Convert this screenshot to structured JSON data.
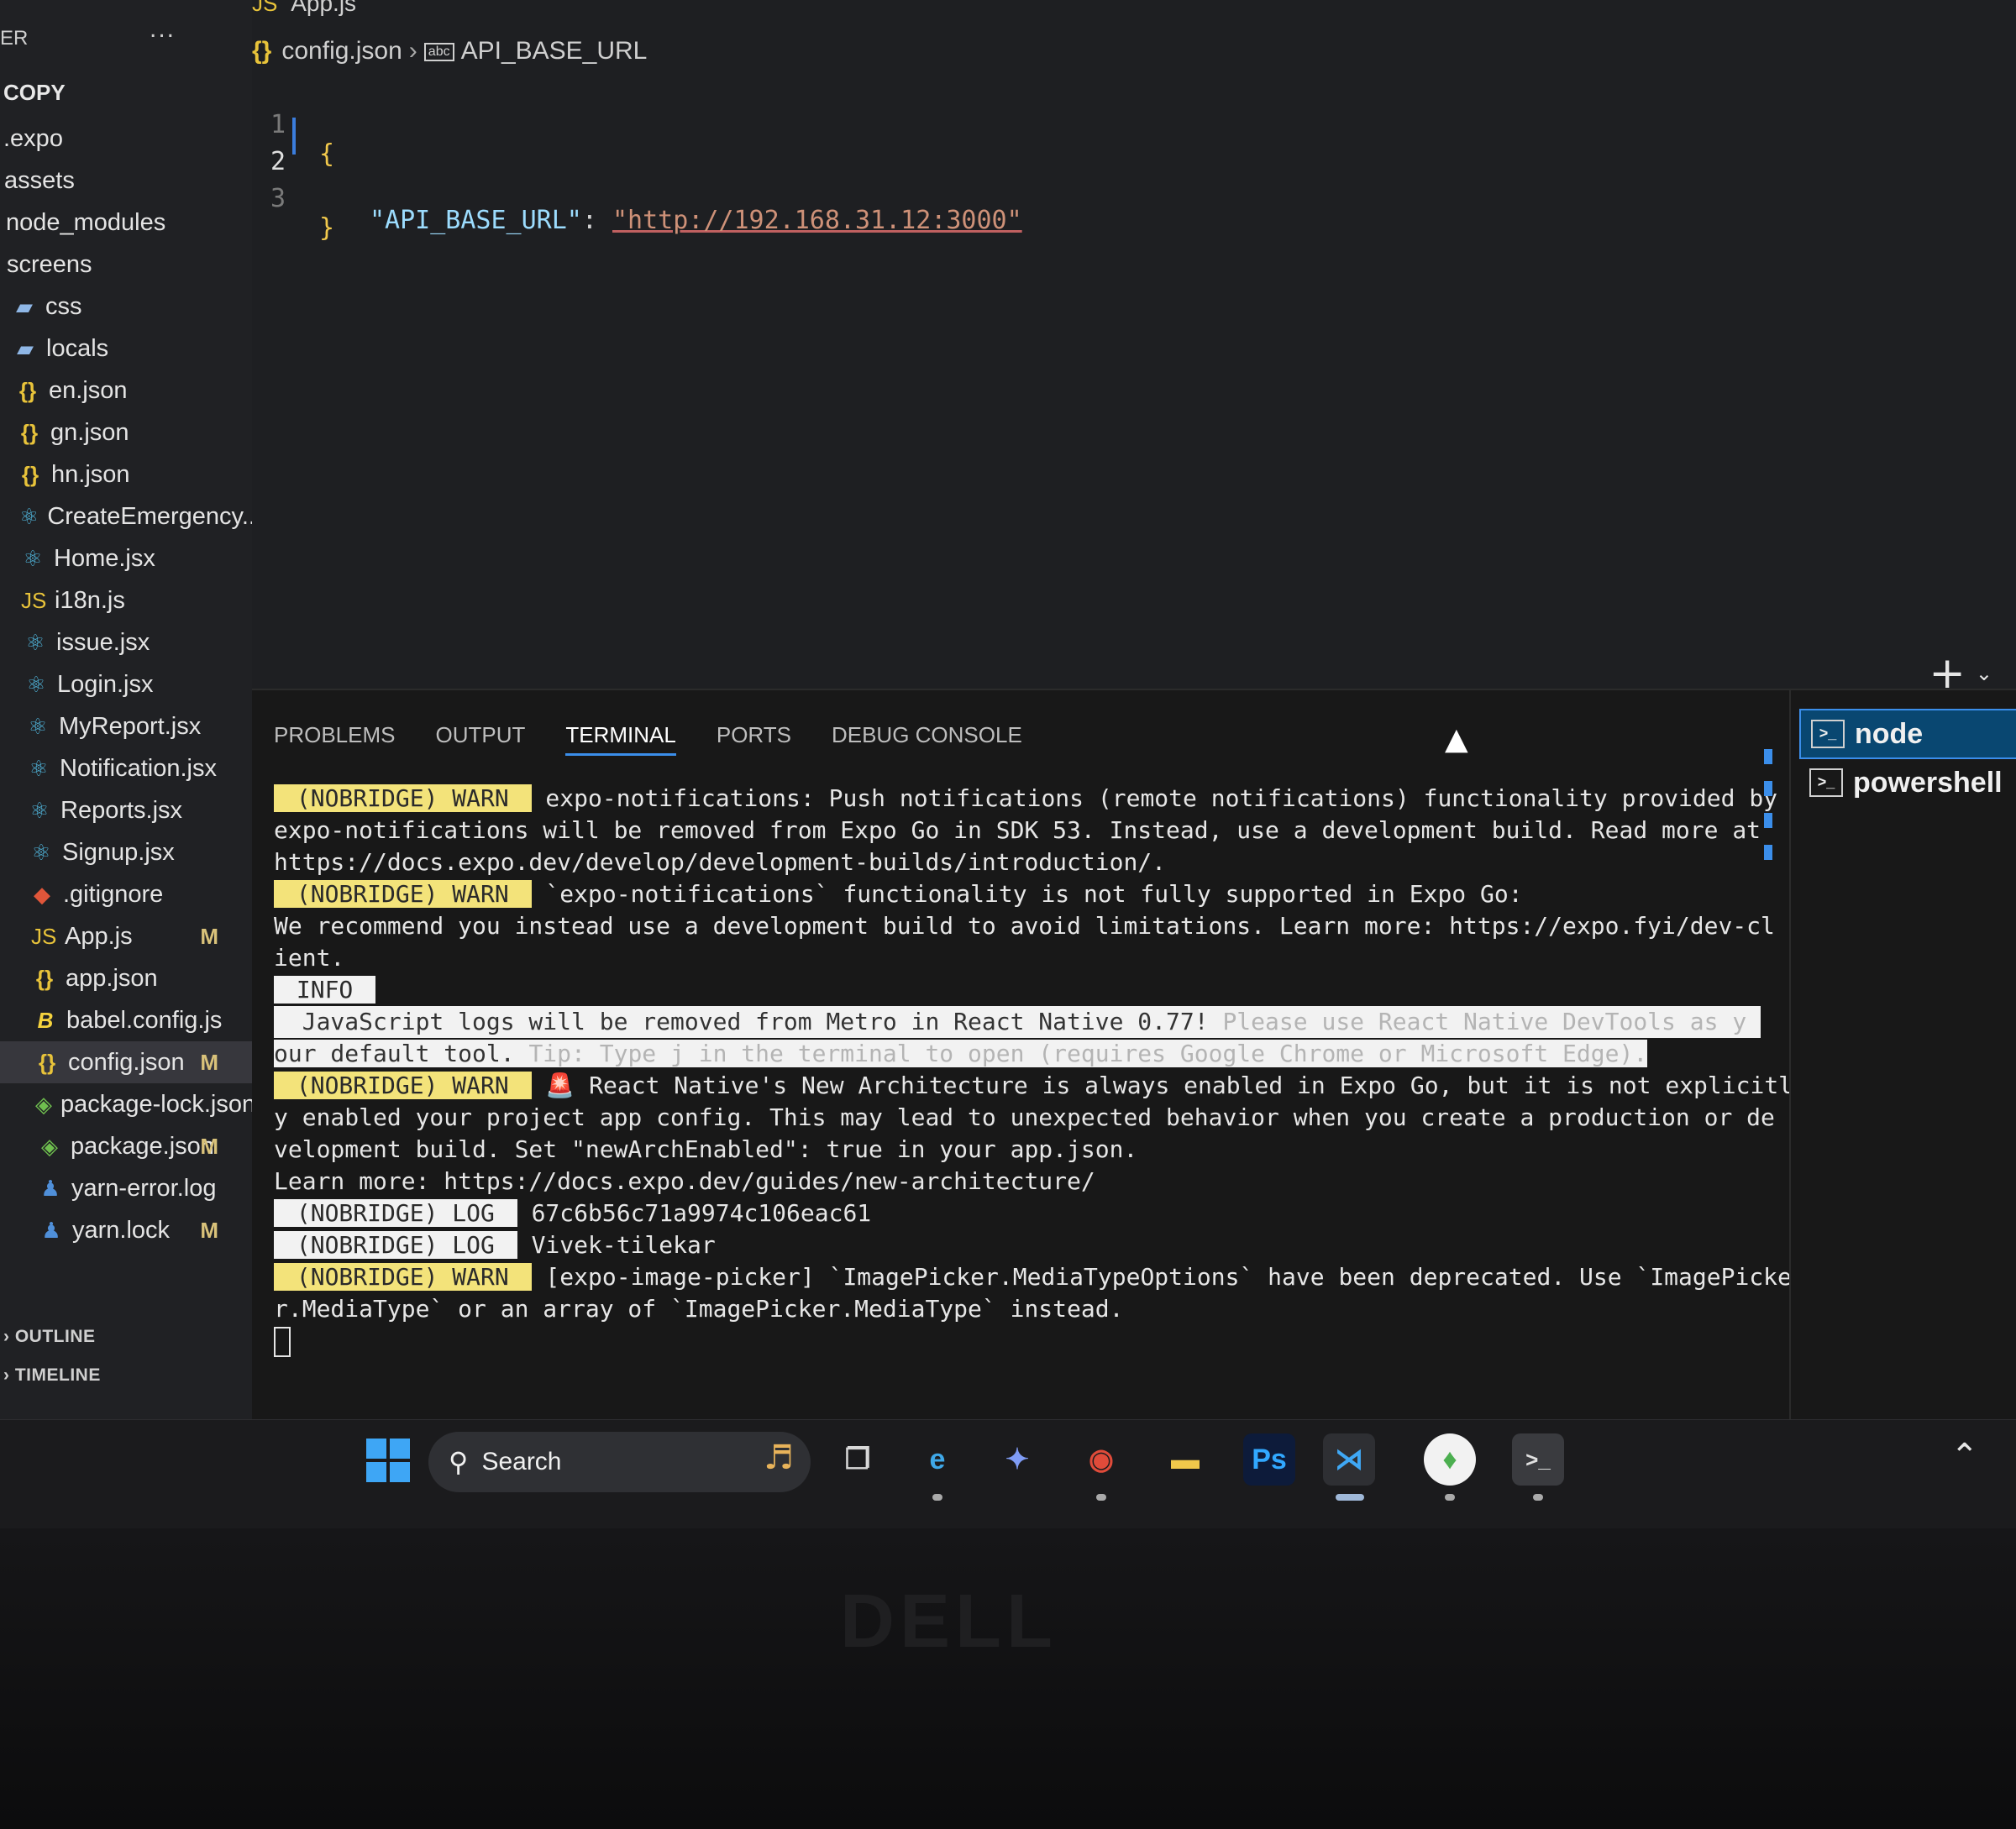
{
  "sidebar": {
    "title": "ER",
    "more": "...",
    "root": "COPY",
    "items": [
      {
        "label": ".expo",
        "icon": "none",
        "status": ""
      },
      {
        "label": "assets",
        "icon": "none",
        "status": ""
      },
      {
        "label": "node_modules",
        "icon": "none",
        "status": ""
      },
      {
        "label": "screens",
        "icon": "none",
        "status": ""
      },
      {
        "label": "css",
        "icon": "folder",
        "status": ""
      },
      {
        "label": "locals",
        "icon": "folder",
        "status": ""
      },
      {
        "label": "en.json",
        "icon": "json",
        "status": ""
      },
      {
        "label": "gn.json",
        "icon": "json",
        "status": ""
      },
      {
        "label": "hn.json",
        "icon": "json",
        "status": ""
      },
      {
        "label": "CreateEmergency...",
        "icon": "react",
        "status": ""
      },
      {
        "label": "Home.jsx",
        "icon": "react",
        "status": ""
      },
      {
        "label": "i18n.js",
        "icon": "js",
        "status": ""
      },
      {
        "label": "issue.jsx",
        "icon": "react",
        "status": ""
      },
      {
        "label": "Login.jsx",
        "icon": "react",
        "status": ""
      },
      {
        "label": "MyReport.jsx",
        "icon": "react",
        "status": ""
      },
      {
        "label": "Notification.jsx",
        "icon": "react",
        "status": ""
      },
      {
        "label": "Reports.jsx",
        "icon": "react",
        "status": ""
      },
      {
        "label": "Signup.jsx",
        "icon": "react",
        "status": ""
      },
      {
        "label": ".gitignore",
        "icon": "git",
        "status": ""
      },
      {
        "label": "App.js",
        "icon": "js",
        "status": "M"
      },
      {
        "label": "app.json",
        "icon": "json",
        "status": ""
      },
      {
        "label": "babel.config.js",
        "icon": "babel",
        "status": ""
      },
      {
        "label": "config.json",
        "icon": "json",
        "status": "M",
        "selected": true
      },
      {
        "label": "package-lock.json",
        "icon": "npm",
        "status": ""
      },
      {
        "label": "package.json",
        "icon": "npm",
        "status": "M"
      },
      {
        "label": "yarn-error.log",
        "icon": "yarn",
        "status": ""
      },
      {
        "label": "yarn.lock",
        "icon": "yarn",
        "status": "M"
      }
    ],
    "outline": "OUTLINE",
    "timeline": "TIMELINE"
  },
  "editor": {
    "tab": "App.js",
    "breadcrumb_file": "config.json",
    "breadcrumb_symbol": "API_BASE_URL",
    "lines": [
      {
        "num": "1",
        "open": "{"
      },
      {
        "num": "2",
        "key": "\"API_BASE_URL\"",
        "colon": ": ",
        "value": "\"http://192.168.31.12:3000\""
      },
      {
        "num": "3",
        "close": "}"
      }
    ]
  },
  "panel": {
    "tabs": [
      "PROBLEMS",
      "OUTPUT",
      "TERMINAL",
      "PORTS",
      "DEBUG CONSOLE"
    ],
    "active_tab": "TERMINAL",
    "add": "+",
    "terminal": {
      "warn_badge": " (NOBRIDGE) WARN ",
      "log_badge": " (NOBRIDGE) LOG ",
      "info_badge": " INFO ",
      "w1_a": " expo-notifications: Push notifications (remote notifications) functionality provided by",
      "w1_b": "expo-notifications will be removed from Expo Go in SDK 53. Instead, use a development build. Read more at",
      "w1_c": "https://docs.expo.dev/develop/development-builds/introduction/.",
      "w2_a": " `expo-notifications` functionality is not fully supported in Expo Go:",
      "w2_b": "We recommend you instead use a development build to avoid limitations. Learn more: https://expo.fyi/dev-cl",
      "w2_c": "ient.",
      "info_a": "  JavaScript logs will be removed from Metro in React Native 0.77! ",
      "info_a_dim": "Please use React Native DevTools as y",
      "info_b": "our default tool. ",
      "info_b_dim": "Tip: Type j in the terminal to open (requires Google Chrome or Microsoft Edge).",
      "w3_a": " 🚨 React Native's New Architecture is always enabled in Expo Go, but it is not explicitl",
      "w3_b": "y enabled your project app config. This may lead to unexpected behavior when you create a production or de",
      "w3_c": "velopment build. Set \"newArchEnabled\": true in your app.json.",
      "w3_d": "Learn more: https://docs.expo.dev/guides/new-architecture/",
      "log1": " 67c6b56c71a9974c106eac61",
      "log2": " Vivek-tilekar",
      "w4_a": " [expo-image-picker] `ImagePicker.MediaTypeOptions` have been deprecated. Use `ImagePicke",
      "w4_b": "r.MediaType` or an array of `ImagePicker.MediaType` instead."
    },
    "terminal_list": [
      {
        "label": "node",
        "active": true
      },
      {
        "label": "powershell",
        "active": false
      }
    ]
  },
  "taskbar": {
    "search_label": "Search",
    "apps": [
      {
        "name": "task-view",
        "glyph": "❐"
      },
      {
        "name": "edge",
        "glyph": "e"
      },
      {
        "name": "copilot",
        "glyph": "✦"
      },
      {
        "name": "chrome",
        "glyph": "◉"
      },
      {
        "name": "file-explorer",
        "glyph": "▬"
      },
      {
        "name": "photoshop",
        "glyph": "Ps"
      },
      {
        "name": "vscode",
        "glyph": "⋊"
      },
      {
        "name": "mongodb-compass",
        "glyph": "♦"
      },
      {
        "name": "terminal",
        "glyph": ">_"
      }
    ]
  },
  "colors": {
    "accent": "#3b8eea",
    "warn_badge": "#f3e37a",
    "json_icon": "#e8c33a",
    "react_icon": "#4fb3d9"
  },
  "icons": {
    "json": "{}",
    "react": "⚛",
    "js": "JS",
    "folder": "▰",
    "git": "◆",
    "babel": "B",
    "npm": "◈",
    "yarn": "♟"
  },
  "bezel": {
    "brand": "DELL"
  }
}
